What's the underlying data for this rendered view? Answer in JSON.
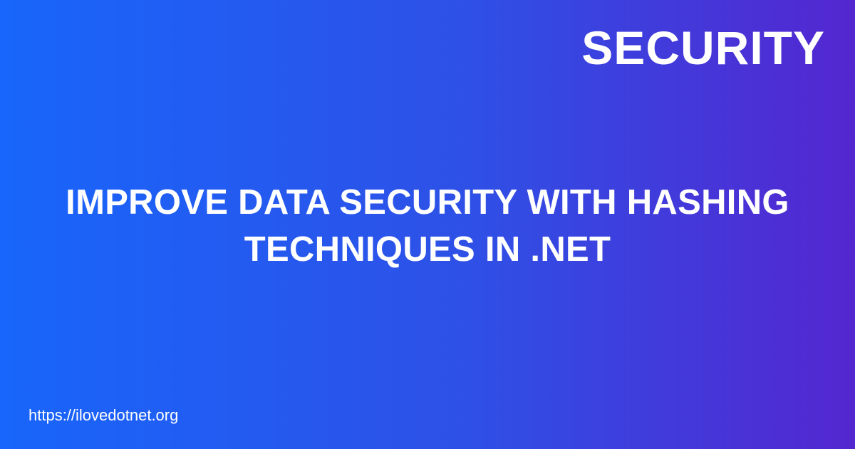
{
  "category": "SECURITY",
  "headline": {
    "line1": "IMPROVE DATA SECURITY WITH HASHING",
    "line2": "TECHNIQUES IN .NET"
  },
  "site_url": "https://ilovedotnet.org",
  "colors": {
    "gradient_start": "#1866fb",
    "gradient_end": "#5426d0",
    "text": "#ffffff"
  }
}
